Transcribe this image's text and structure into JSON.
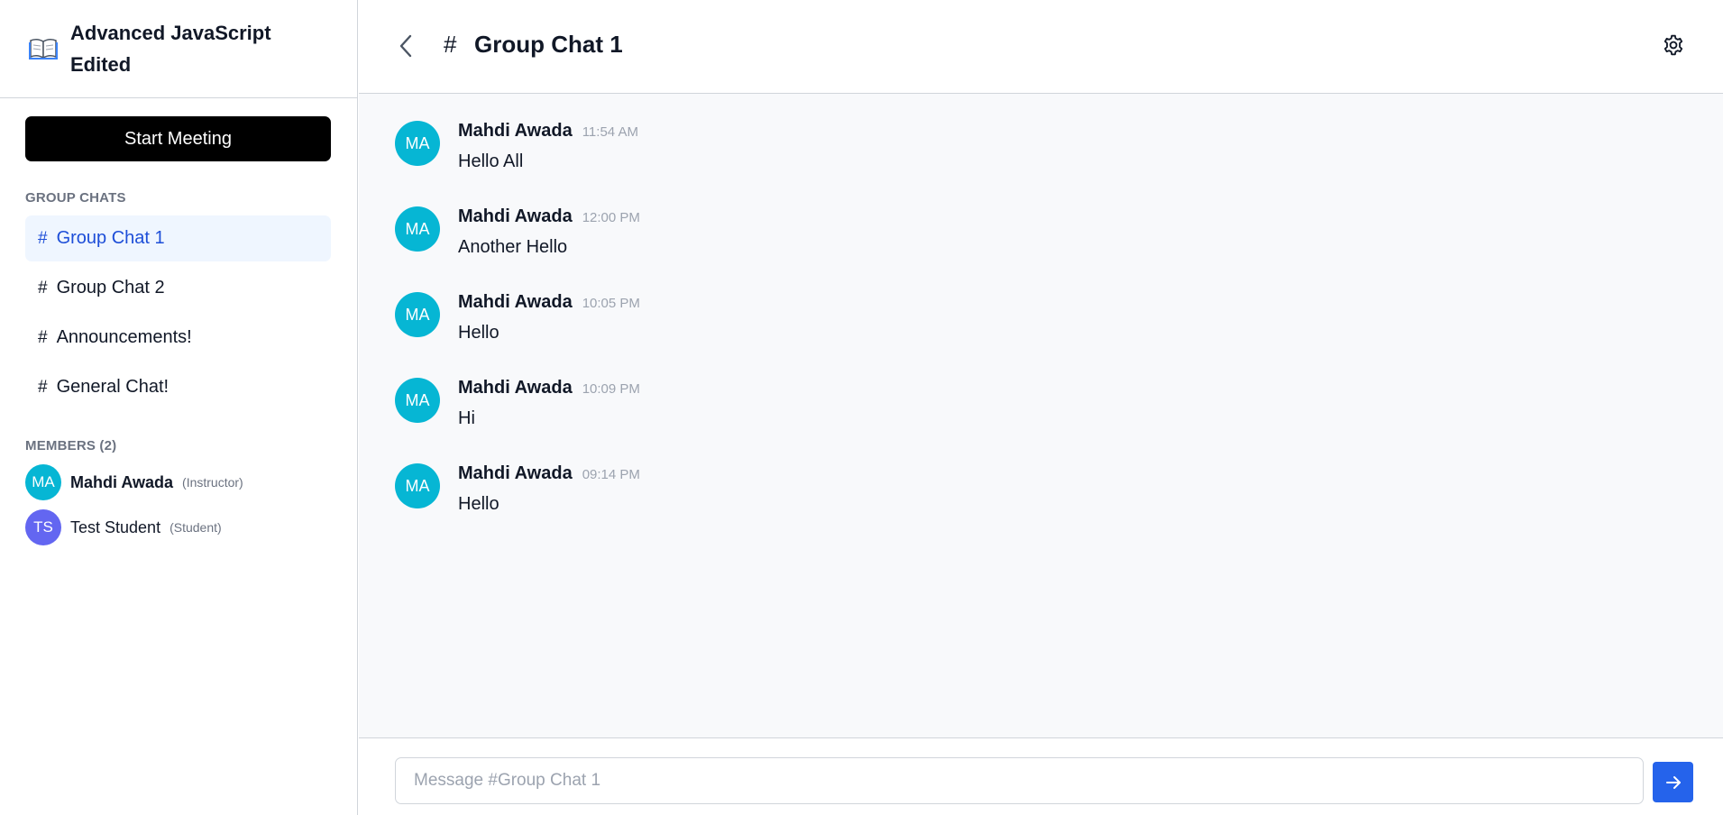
{
  "course": {
    "title_line1": "Advanced JavaScript",
    "title_line2": "Edited",
    "icon": "open-book-icon"
  },
  "sidebar": {
    "start_meeting_label": "Start Meeting",
    "group_chats_label": "GROUP CHATS",
    "chats": [
      {
        "label": "Group Chat 1",
        "active": true
      },
      {
        "label": "Group Chat 2",
        "active": false
      },
      {
        "label": "Announcements!",
        "active": false
      },
      {
        "label": "General Chat!",
        "active": false
      }
    ],
    "members_label": "MEMBERS (2)",
    "members": [
      {
        "initials": "MA",
        "name": "Mahdi Awada",
        "role": "(Instructor)",
        "color": "#06b6d4"
      },
      {
        "initials": "TS",
        "name": "Test Student",
        "role": "(Student)",
        "color": "#6366f1"
      }
    ]
  },
  "header": {
    "hash": "#",
    "title": "Group Chat 1"
  },
  "messages": [
    {
      "initials": "MA",
      "author": "Mahdi Awada",
      "time": "11:54 AM",
      "text": "Hello All"
    },
    {
      "initials": "MA",
      "author": "Mahdi Awada",
      "time": "12:00 PM",
      "text": "Another Hello"
    },
    {
      "initials": "MA",
      "author": "Mahdi Awada",
      "time": "10:05 PM",
      "text": "Hello"
    },
    {
      "initials": "MA",
      "author": "Mahdi Awada",
      "time": "10:09 PM",
      "text": "Hi"
    },
    {
      "initials": "MA",
      "author": "Mahdi Awada",
      "time": "09:14 PM",
      "text": "Hello"
    }
  ],
  "composer": {
    "placeholder": "Message #Group Chat 1",
    "value": ""
  },
  "colors": {
    "accent": "#2563eb",
    "active_chat_bg": "#eff6ff",
    "active_chat_text": "#1d4ed8",
    "avatar_instructor": "#06b6d4",
    "avatar_student": "#6366f1"
  }
}
